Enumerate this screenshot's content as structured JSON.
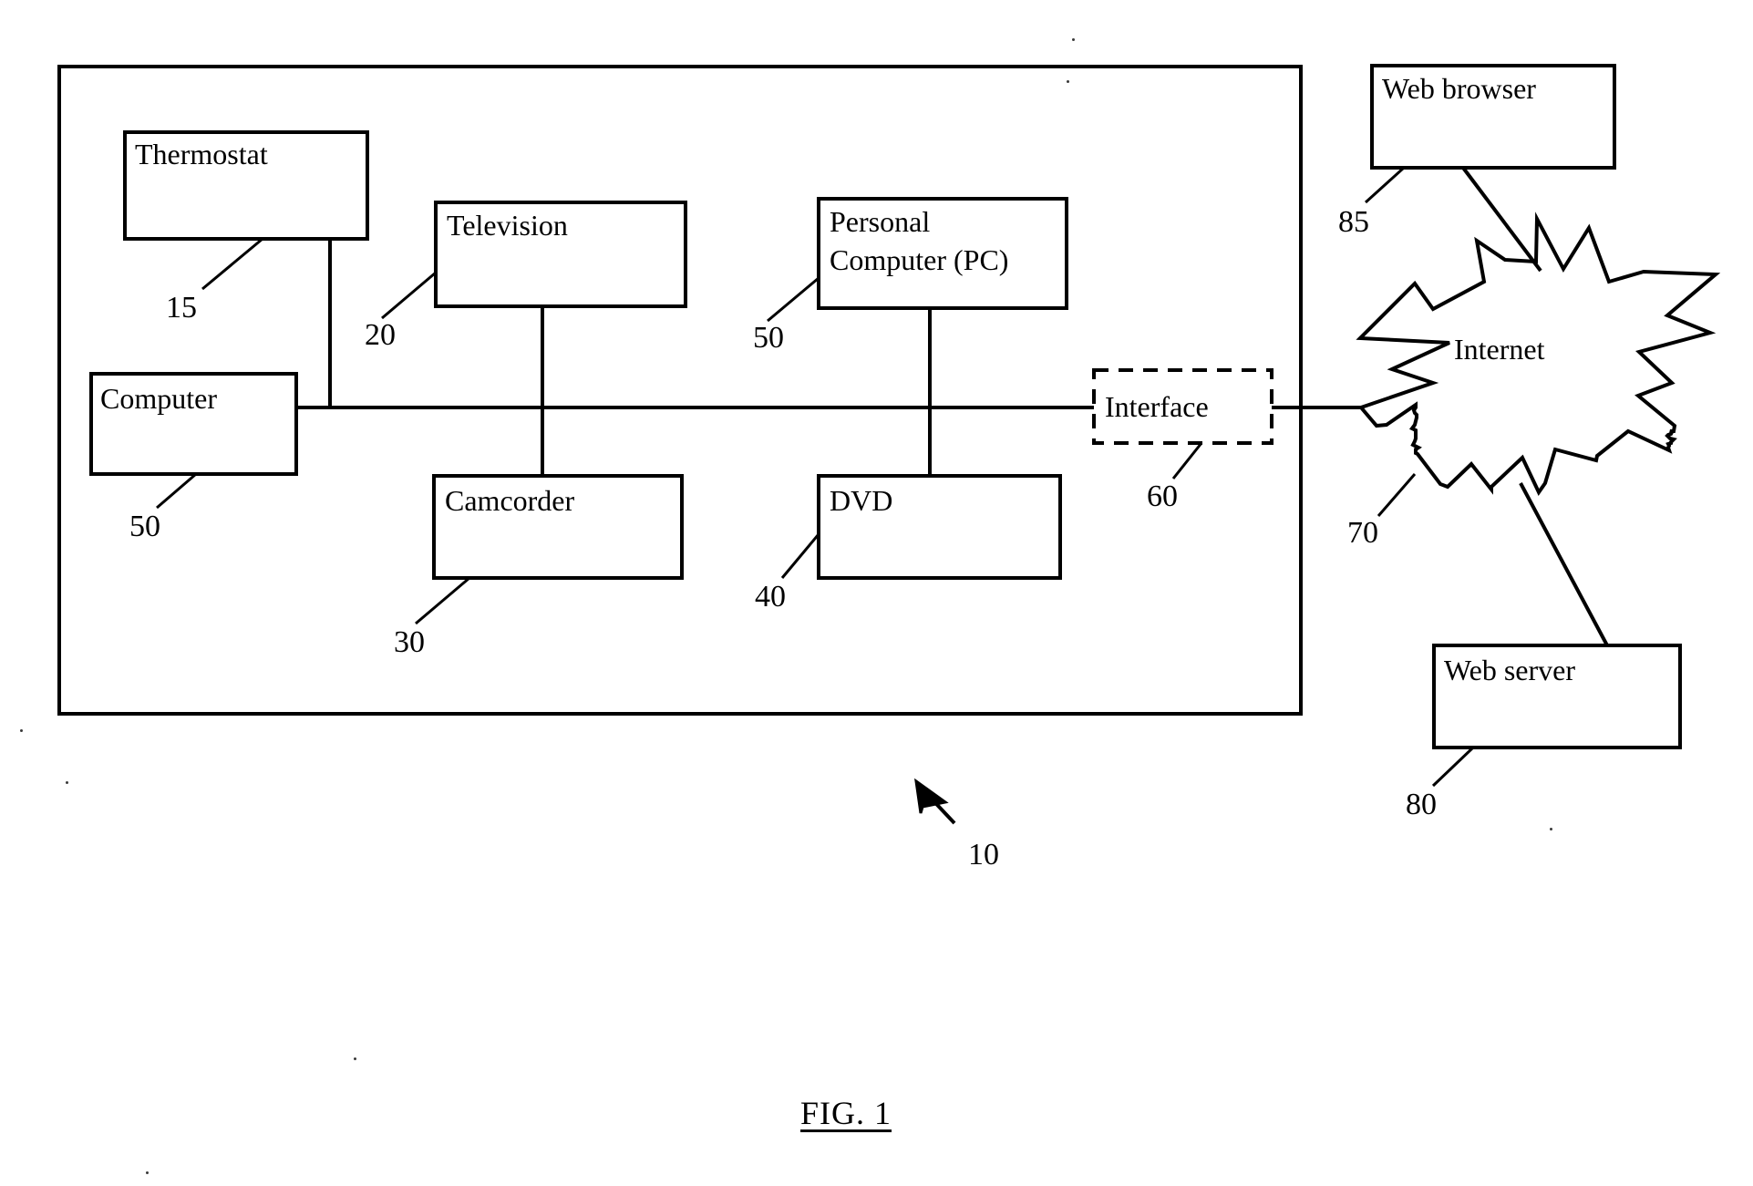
{
  "figure": {
    "caption": "FIG. 1",
    "system_ref": "10"
  },
  "system_boundary": {
    "name": "home-network-boundary",
    "ref": "10"
  },
  "nodes": [
    {
      "id": "thermostat",
      "label": "Thermostat",
      "ref": "15",
      "style": "solid"
    },
    {
      "id": "television",
      "label": "Television",
      "ref": "20",
      "style": "solid"
    },
    {
      "id": "personal_computer",
      "label_line1": "Personal",
      "label_line2": "Computer (PC)",
      "ref": "50",
      "style": "solid"
    },
    {
      "id": "computer",
      "label": "Computer",
      "ref": "50",
      "style": "solid"
    },
    {
      "id": "camcorder",
      "label": "Camcorder",
      "ref": "30",
      "style": "solid"
    },
    {
      "id": "dvd",
      "label": "DVD",
      "ref": "40",
      "style": "solid"
    },
    {
      "id": "interface",
      "label": "Interface",
      "ref": "60",
      "style": "dashed"
    },
    {
      "id": "internet",
      "label": "Internet",
      "ref": "70",
      "style": "starburst"
    },
    {
      "id": "web_browser",
      "label": "Web browser",
      "ref": "85",
      "style": "solid"
    },
    {
      "id": "web_server",
      "label": "Web server",
      "ref": "80",
      "style": "solid"
    }
  ],
  "labels": {
    "thermostat": "Thermostat",
    "television": "Television",
    "pc_line1": "Personal",
    "pc_line2": "Computer (PC)",
    "computer": "Computer",
    "camcorder": "Camcorder",
    "dvd": "DVD",
    "interface": "Interface",
    "internet": "Internet",
    "web_browser": "Web browser",
    "web_server": "Web server"
  },
  "refs": {
    "thermostat": "15",
    "television": "20",
    "pc": "50",
    "computer": "50",
    "camcorder": "30",
    "dvd": "40",
    "interface": "60",
    "internet": "70",
    "web_browser": "85",
    "web_server": "80",
    "system": "10"
  },
  "colors": {
    "line": "#000000",
    "background": "#ffffff",
    "text": "#000000"
  }
}
